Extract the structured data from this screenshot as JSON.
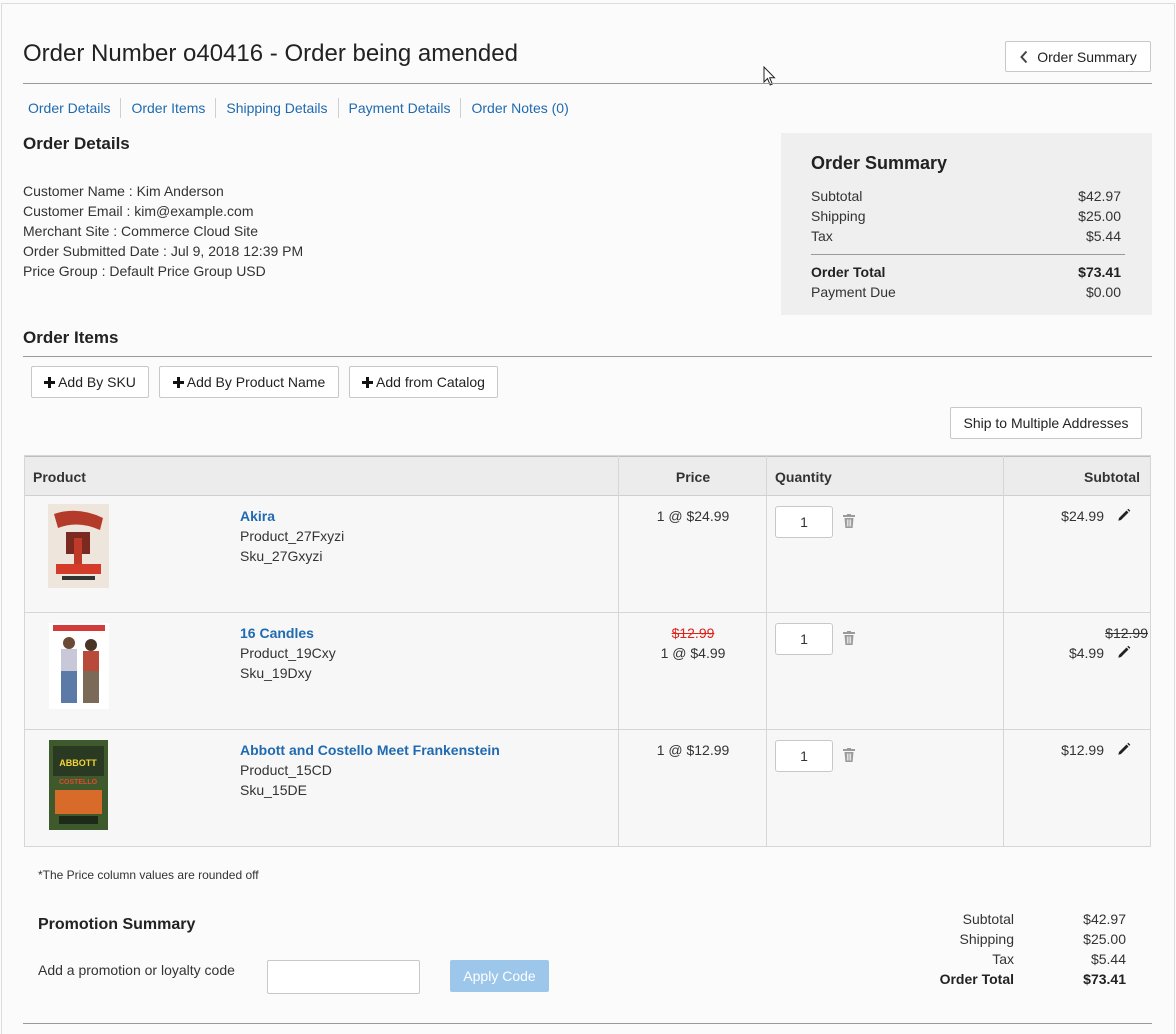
{
  "header": {
    "title": "Order Number o40416 - Order being amended",
    "order_summary_button": "Order Summary"
  },
  "tabs": [
    "Order Details",
    "Order Items",
    "Shipping Details",
    "Payment Details",
    "Order Notes (0)"
  ],
  "order_details": {
    "heading": "Order Details",
    "lines": [
      "Customer Name : Kim Anderson",
      "Customer Email : kim@example.com",
      "Merchant Site : Commerce Cloud Site",
      "Order Submitted Date : Jul 9, 2018 12:39 PM",
      "Price Group : Default Price Group USD"
    ]
  },
  "order_summary": {
    "heading": "Order Summary",
    "subtotal_label": "Subtotal",
    "subtotal": "$42.97",
    "shipping_label": "Shipping",
    "shipping": "$25.00",
    "tax_label": "Tax",
    "tax": "$5.44",
    "total_label": "Order Total",
    "total": "$73.41",
    "due_label": "Payment Due",
    "due": "$0.00"
  },
  "order_items": {
    "heading": "Order Items",
    "add_by_sku": "Add By SKU",
    "add_by_name": "Add By Product Name",
    "add_from_catalog": "Add from Catalog",
    "ship_multiple": "Ship to Multiple Addresses",
    "columns": {
      "product": "Product",
      "price": "Price",
      "quantity": "Quantity",
      "subtotal": "Subtotal"
    },
    "rows": [
      {
        "name": "Akira",
        "product_id": "Product_27Fxyzi",
        "sku": "Sku_27Gxyzi",
        "price_old": "",
        "price": "1 @ $24.99",
        "qty": "1",
        "sub_old": "",
        "subtotal": "$24.99"
      },
      {
        "name": "16 Candles",
        "product_id": "Product_19Cxy",
        "sku": "Sku_19Dxy",
        "price_old": "$12.99",
        "price": "1 @ $4.99",
        "qty": "1",
        "sub_old": "$12.99",
        "subtotal": "$4.99"
      },
      {
        "name": "Abbott and Costello Meet Frankenstein",
        "product_id": "Product_15CD",
        "sku": "Sku_15DE",
        "price_old": "",
        "price": "1 @ $12.99",
        "qty": "1",
        "sub_old": "",
        "subtotal": "$12.99"
      }
    ],
    "note": "*The Price column values are rounded off"
  },
  "promotion": {
    "heading": "Promotion Summary",
    "label": "Add a promotion or loyalty code",
    "input_value": "",
    "apply": "Apply Code"
  },
  "totals": {
    "subtotal_label": "Subtotal",
    "subtotal": "$42.97",
    "shipping_label": "Shipping",
    "shipping": "$25.00",
    "tax_label": "Tax",
    "tax": "$5.44",
    "total_label": "Order Total",
    "total": "$73.41"
  },
  "colors": {
    "link": "#1f6ab0",
    "strike": "#e0201b",
    "apply_bg": "#9dc6eb",
    "summary_bg": "#efefef"
  },
  "icons": [
    "chevron-left-icon",
    "plus-icon",
    "trash-icon",
    "pencil-icon",
    "mouse-cursor-icon"
  ]
}
